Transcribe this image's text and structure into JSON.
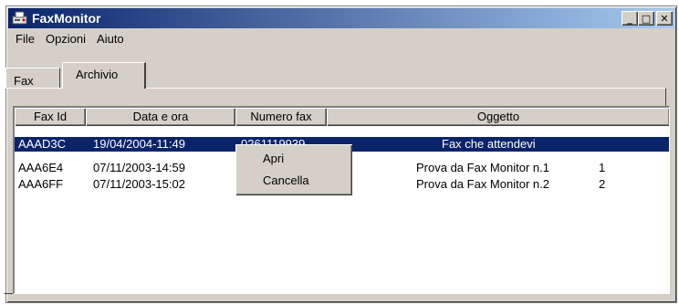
{
  "window": {
    "title": "FaxMonitor",
    "minimize_label": "_",
    "maximize_label": "□",
    "close_label": "✕"
  },
  "menu": {
    "file": "File",
    "options": "Opzioni",
    "help": "Aiuto"
  },
  "tabs": {
    "fax": "Fax",
    "archive": "Archivio"
  },
  "table": {
    "headers": [
      "Fax Id",
      "Data e ora",
      "Numero fax",
      "Oggetto"
    ],
    "rows": [
      {
        "id": "AAAD3C",
        "datetime": "19/04/2004-11:49",
        "number": "0261119939",
        "subject": "Fax che attendevi",
        "extra": ""
      },
      {
        "id": "AAA6E4",
        "datetime": "07/11/2003-14:59",
        "number": "",
        "subject": "Prova da Fax Monitor n.1",
        "extra": "1"
      },
      {
        "id": "AAA6FF",
        "datetime": "07/11/2003-15:02",
        "number": "",
        "subject": "Prova da Fax Monitor n.2",
        "extra": "2"
      }
    ]
  },
  "context_menu": {
    "open": "Apri",
    "delete": "Cancella"
  },
  "colors": {
    "title_start": "#0a246a",
    "title_end": "#a6caf0",
    "selection": "#0a246a",
    "face": "#d4d0c8"
  },
  "icons": {
    "app": "fax-app-icon"
  }
}
